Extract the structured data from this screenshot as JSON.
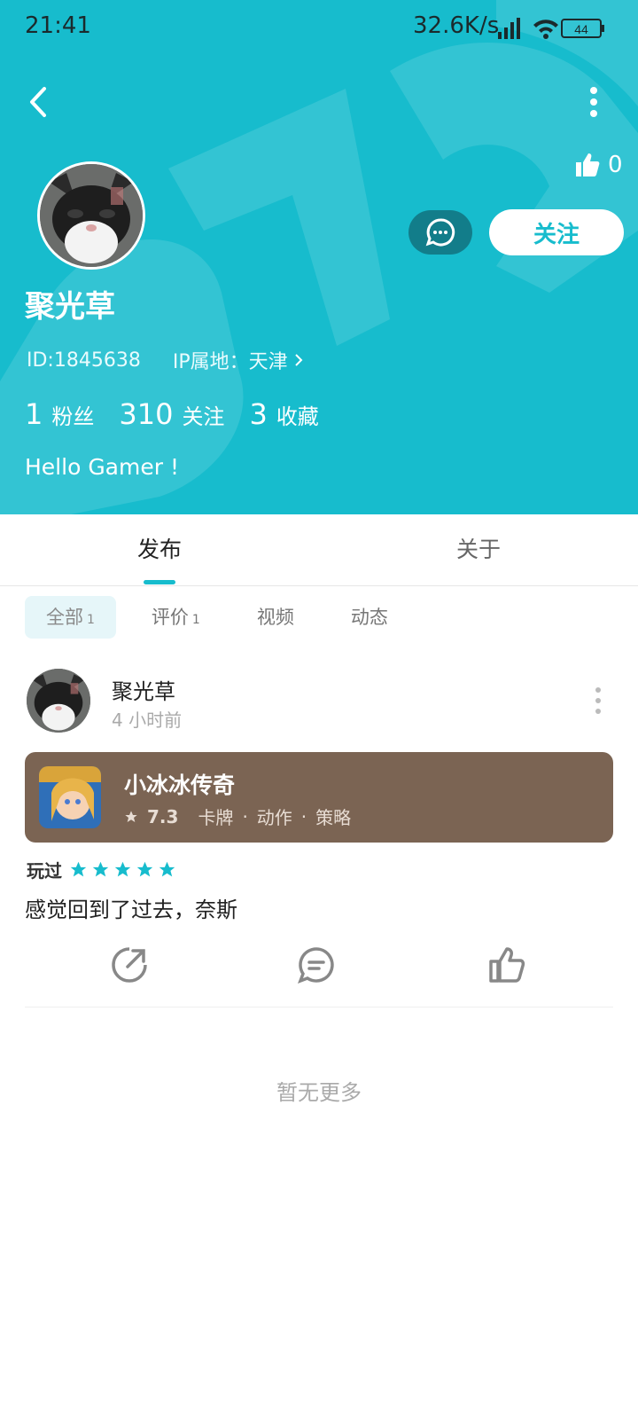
{
  "status_bar": {
    "time": "21:41",
    "speed": "32.6K/s",
    "battery": "44"
  },
  "header": {
    "like_count": "0",
    "message_icon": "chat-bubble-icon",
    "follow_label": "关注",
    "username": "聚光草",
    "user_id": "ID:1845638",
    "ip_location": "IP属地：天津",
    "stats": [
      {
        "num": "1",
        "label": "粉丝"
      },
      {
        "num": "310",
        "label": "关注"
      },
      {
        "num": "3",
        "label": "收藏"
      }
    ],
    "bio": "Hello Gamer !",
    "accent_color": "#17bccd"
  },
  "tabs": {
    "publish": "发布",
    "about": "关于"
  },
  "filters": [
    {
      "label": "全部",
      "count": "1"
    },
    {
      "label": "评价",
      "count": "1"
    },
    {
      "label": "视频",
      "count": ""
    },
    {
      "label": "动态",
      "count": ""
    }
  ],
  "post": {
    "author": "聚光草",
    "time": "4 小时前",
    "game": {
      "name": "小冰冰传奇",
      "rating": "7.3",
      "tags": [
        "卡牌",
        "动作",
        "策略"
      ]
    },
    "played_label": "玩过",
    "stars": 5,
    "review": "感觉回到了过去，奈斯"
  },
  "footer": {
    "no_more": "暂无更多"
  }
}
